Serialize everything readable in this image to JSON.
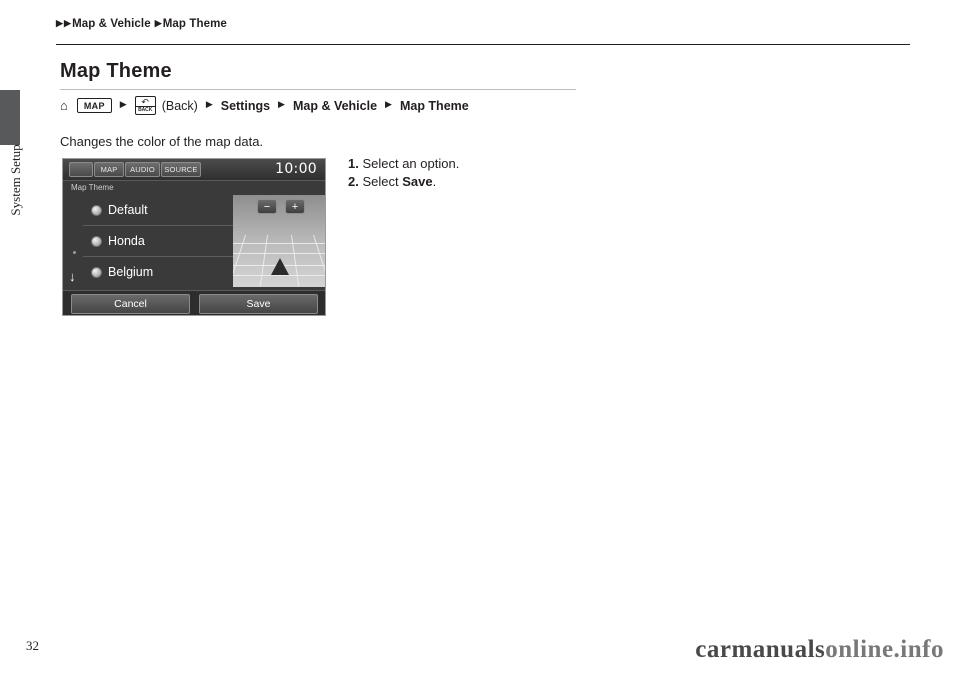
{
  "breadcrumb": {
    "arrow": "▶",
    "level1": "Map & Vehicle",
    "level2": "Map Theme"
  },
  "side_tab": {
    "label": "System Setup"
  },
  "page_title": "Map Theme",
  "nav_path": {
    "home_icon": "⌂",
    "map_button": "MAP",
    "arrow": "▶",
    "back_icon": "↶",
    "back_button_label": "BACK",
    "back_word": "(Back)",
    "settings": "Settings",
    "map_vehicle": "Map & Vehicle",
    "map_theme": "Map Theme"
  },
  "intro_text": "Changes the color of the map data.",
  "steps": [
    {
      "num": "1.",
      "text": " Select an option."
    },
    {
      "num": "2.",
      "text": " Select ",
      "strong": "Save",
      "tail": "."
    }
  ],
  "screen": {
    "tabs": {
      "blank": "",
      "map": "MAP",
      "audio": "AUDIO",
      "source": "SOURCE"
    },
    "clock": "10:00",
    "subtitle": "Map Theme",
    "options": [
      "Default",
      "Honda",
      "Belgium"
    ],
    "zoom_out": "−",
    "zoom_in": "+",
    "scroll_down_icon": "↓",
    "buttons": {
      "cancel": "Cancel",
      "save": "Save"
    }
  },
  "footer": {
    "page_number": "32",
    "watermark_main": "carmanuals",
    "watermark_dim": "online.info"
  }
}
